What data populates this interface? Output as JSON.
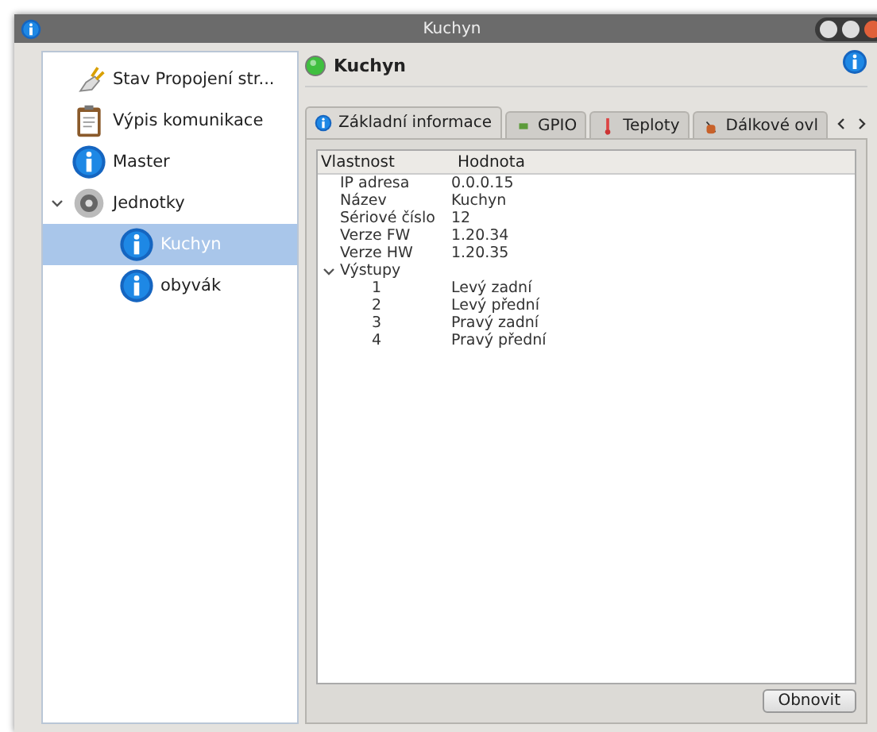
{
  "window": {
    "title": "Kuchyn"
  },
  "sidebar": {
    "items": [
      {
        "label": "Stav Propojení str...",
        "kind": "plug",
        "selected": false
      },
      {
        "label": "Výpis komunikace",
        "kind": "clipboard",
        "selected": false
      },
      {
        "label": "Master",
        "kind": "info",
        "selected": false
      },
      {
        "label": "Jednotky",
        "kind": "speaker",
        "selected": false,
        "expanded": true,
        "children": [
          {
            "label": "Kuchyn",
            "kind": "info",
            "selected": true
          },
          {
            "label": "obyvák",
            "kind": "info",
            "selected": false
          }
        ]
      }
    ]
  },
  "header": {
    "title": "Kuchyn",
    "online": true
  },
  "tabs": [
    {
      "label": "Základní informace",
      "kind": "info",
      "selected": true
    },
    {
      "label": "GPIO",
      "kind": "chip",
      "selected": false
    },
    {
      "label": "Teploty",
      "kind": "thermometer",
      "selected": false
    },
    {
      "label": "Dálkové ovl",
      "kind": "remote",
      "selected": false
    }
  ],
  "table": {
    "columns": [
      "Vlastnost",
      "Hodnota"
    ],
    "rows": [
      {
        "property": "IP adresa",
        "value": "0.0.0.15"
      },
      {
        "property": "Název",
        "value": "Kuchyn"
      },
      {
        "property": "Sériové číslo",
        "value": "12"
      },
      {
        "property": "Verze FW",
        "value": "1.20.34"
      },
      {
        "property": "Verze HW",
        "value": "1.20.35"
      },
      {
        "property": "Výstupy",
        "expanded": true,
        "children": [
          {
            "property": "1",
            "value": "Levý zadní"
          },
          {
            "property": "2",
            "value": "Levý přední"
          },
          {
            "property": "3",
            "value": "Pravý zadní"
          },
          {
            "property": "4",
            "value": "Pravý přední"
          }
        ]
      }
    ]
  },
  "buttons": [
    "Obnovit"
  ]
}
